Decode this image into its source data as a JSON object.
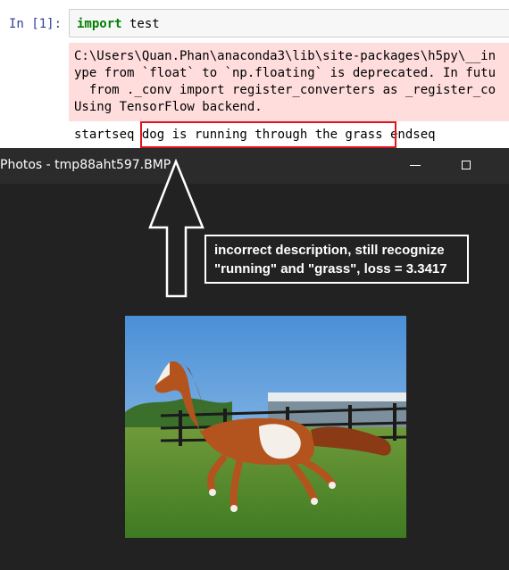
{
  "notebook": {
    "prompt": "In [1]:",
    "input": {
      "keyword": "import",
      "rest": " test"
    },
    "stderr_lines": [
      "C:\\Users\\Quan.Phan\\anaconda3\\lib\\site-packages\\h5py\\__in",
      "ype from `float` to `np.floating` is deprecated. In futu",
      "  from ._conv import register_converters as _register_co",
      "Using TensorFlow backend."
    ],
    "stdout": {
      "start": "startseq ",
      "caption": "dog is running through the grass",
      "end": " endseq"
    }
  },
  "photos_window": {
    "title": "Photos - tmp88aht597.BMP",
    "annotation": "incorrect description, still recognize\n\"running\" and \"grass\", loss = 3.3417"
  },
  "colors": {
    "highlight_border": "#e0141e",
    "stderr_bg": "#ffdddd",
    "window_bg": "#222222"
  }
}
